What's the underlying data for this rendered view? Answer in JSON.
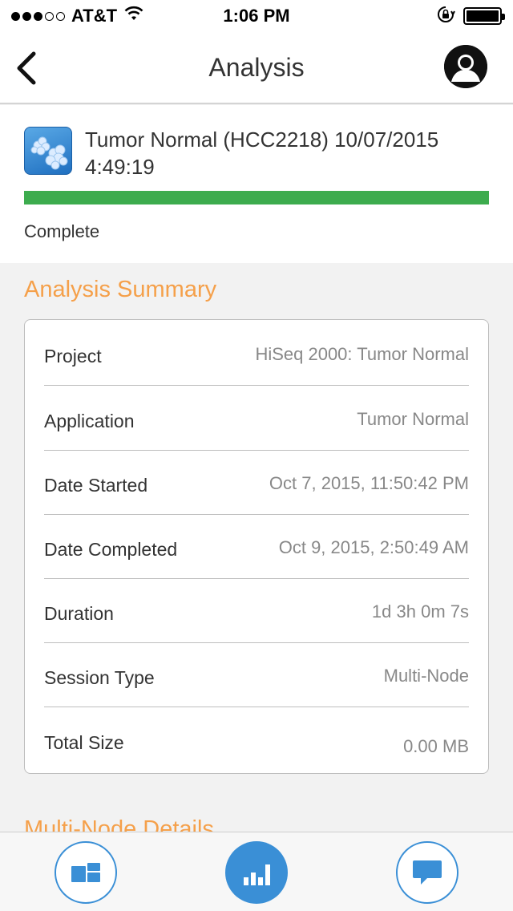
{
  "status_bar": {
    "carrier": "AT&T",
    "time": "1:06 PM",
    "signal_bars_filled": 3,
    "signal_bars_total": 5
  },
  "nav": {
    "title": "Analysis",
    "back_icon": "chevron-left-icon",
    "profile_icon": "user-avatar-icon"
  },
  "run": {
    "title": "Tumor Normal (HCC2218) 10/07/2015 4:49:19",
    "progress_percent": 100,
    "status": "Complete",
    "progress_color": "#3dac4e"
  },
  "summary": {
    "title": "Analysis Summary",
    "rows": [
      {
        "label": "Project",
        "value": "HiSeq 2000: Tumor Normal"
      },
      {
        "label": "Application",
        "value": "Tumor Normal"
      },
      {
        "label": "Date Started",
        "value": "Oct 7, 2015, 11:50:42 PM"
      },
      {
        "label": "Date Completed",
        "value": "Oct 9, 2015, 2:50:49 AM"
      },
      {
        "label": "Duration",
        "value": "1d 3h 0m 7s"
      },
      {
        "label": "Session Type",
        "value": "Multi-Node"
      },
      {
        "label": "Total Size",
        "value": "0.00 MB"
      }
    ]
  },
  "next_section": {
    "title": "Multi-Node Details"
  },
  "tabs": [
    {
      "icon": "dashboard-icon",
      "active": false
    },
    {
      "icon": "bar-chart-icon",
      "active": true
    },
    {
      "icon": "chat-icon",
      "active": false
    }
  ],
  "colors": {
    "accent": "#f5a04a",
    "primary": "#3a8fd6",
    "success": "#3dac4e"
  }
}
